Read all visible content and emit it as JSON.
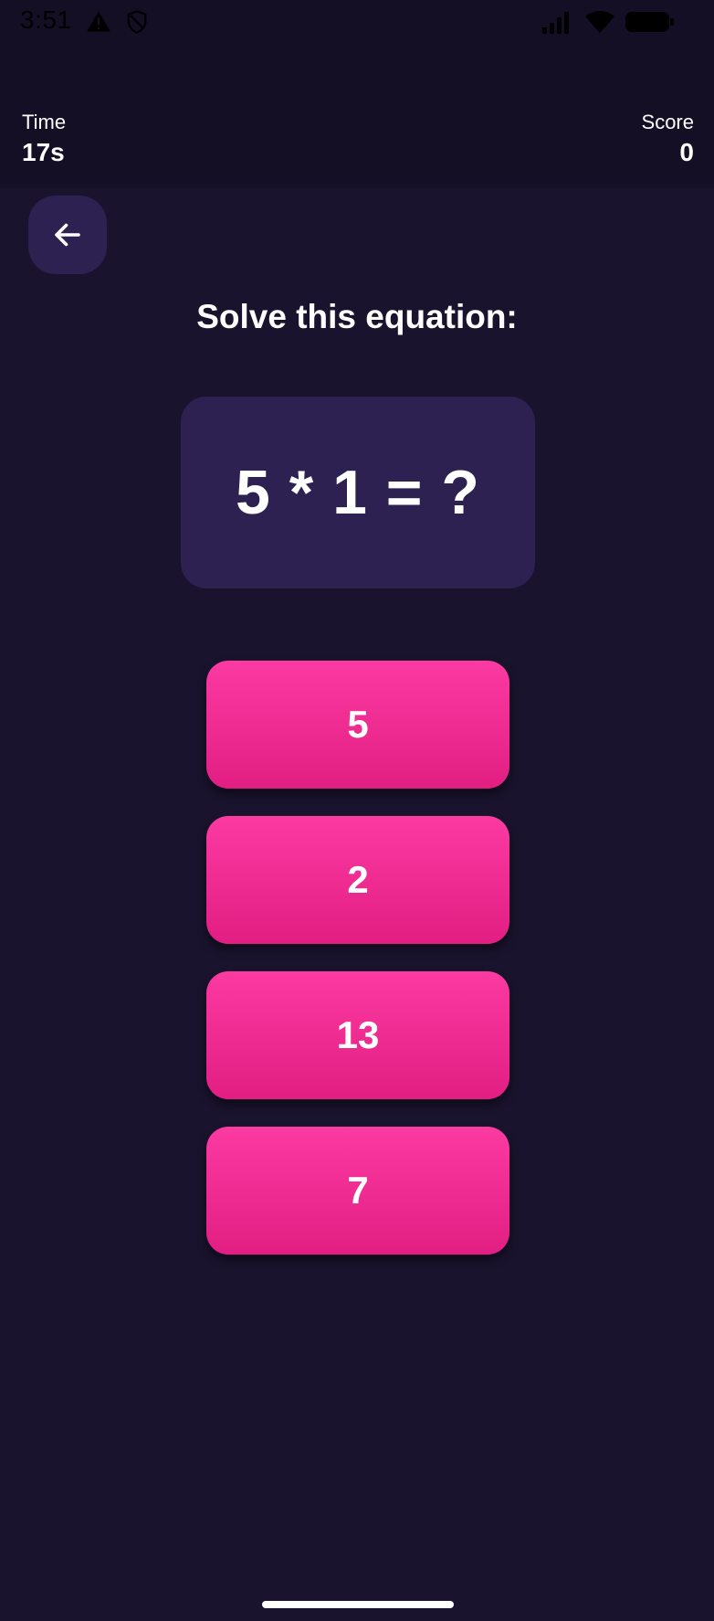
{
  "status_bar": {
    "time": "3:51",
    "icons": [
      "warning-icon",
      "shield-icon",
      "signal-icon",
      "wifi-icon",
      "battery-icon"
    ]
  },
  "header": {
    "time_label": "Time",
    "time_value": "17s",
    "score_label": "Score",
    "score_value": "0"
  },
  "back_button": {
    "icon": "arrow-left-icon"
  },
  "prompt": "Solve this equation:",
  "equation": "5 * 1 = ?",
  "answers": [
    "5",
    "2",
    "13",
    "7"
  ],
  "colors": {
    "background": "#19132d",
    "header_background": "#140f25",
    "card": "#2c2150",
    "answer_gradient_top": "#fb3aa2",
    "answer_gradient_bottom": "#e21e82"
  }
}
